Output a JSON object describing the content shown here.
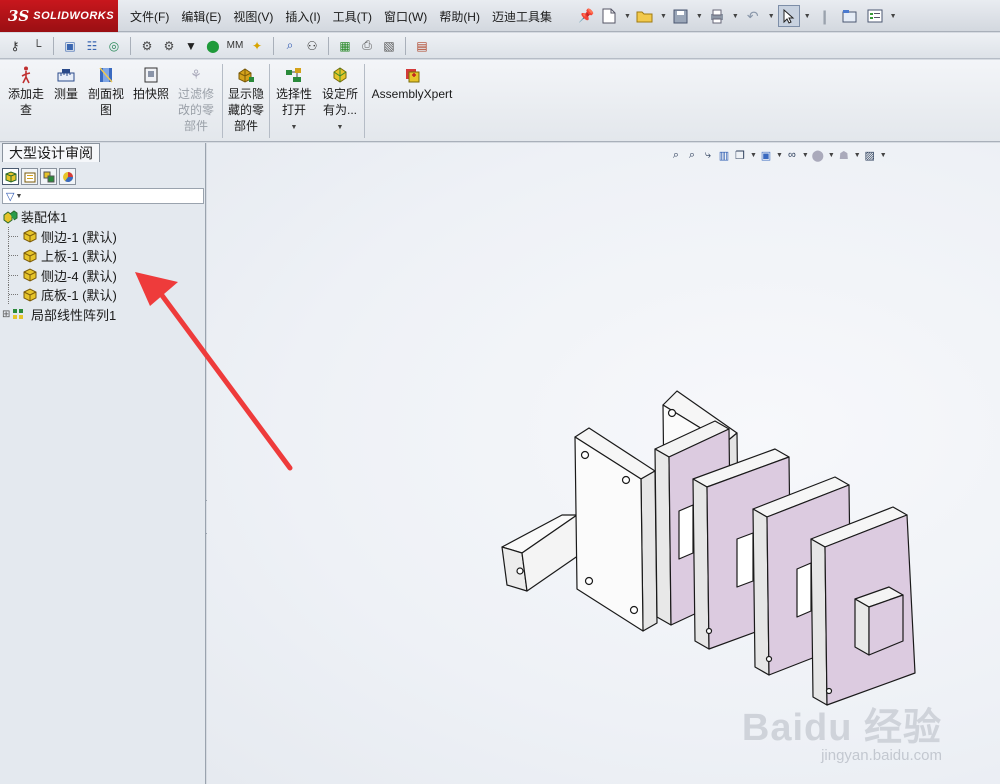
{
  "app": {
    "logo_mark": "3S",
    "logo_text": "SOLIDWORKS"
  },
  "menu": [
    "文件(F)",
    "编辑(E)",
    "视图(V)",
    "插入(I)",
    "工具(T)",
    "窗口(W)",
    "帮助(H)",
    "迈迪工具集"
  ],
  "command_manager": {
    "add_walkthrough": [
      "添加走",
      "查"
    ],
    "measure": "测量",
    "section_view": [
      "剖面视",
      "图"
    ],
    "snapshot": "拍快照",
    "filter_modified": [
      "过滤修",
      "改的零",
      "部件"
    ],
    "show_hidden": [
      "显示隐",
      "藏的零",
      "部件"
    ],
    "selective_open": [
      "选择性",
      "打开"
    ],
    "set_all": [
      "设定所",
      "有为..."
    ],
    "assemblyxpert": "AssemblyXpert"
  },
  "panel": {
    "title": "大型设计审阅",
    "filter_icon": "funnel-icon"
  },
  "tree": {
    "root": "装配体1",
    "children": [
      "侧边-1 (默认)",
      "上板-1 (默认)",
      "侧边-4 (默认)",
      "底板-1 (默认)"
    ],
    "pattern": "局部线性阵列1"
  },
  "watermark": {
    "line1": "Baidu 经验",
    "line2": "jingyan.baidu.com"
  },
  "colors": {
    "accent_red": "#c8171d",
    "face_purple": "#dccbe0",
    "annotation_arrow": "#ee3b3b"
  }
}
